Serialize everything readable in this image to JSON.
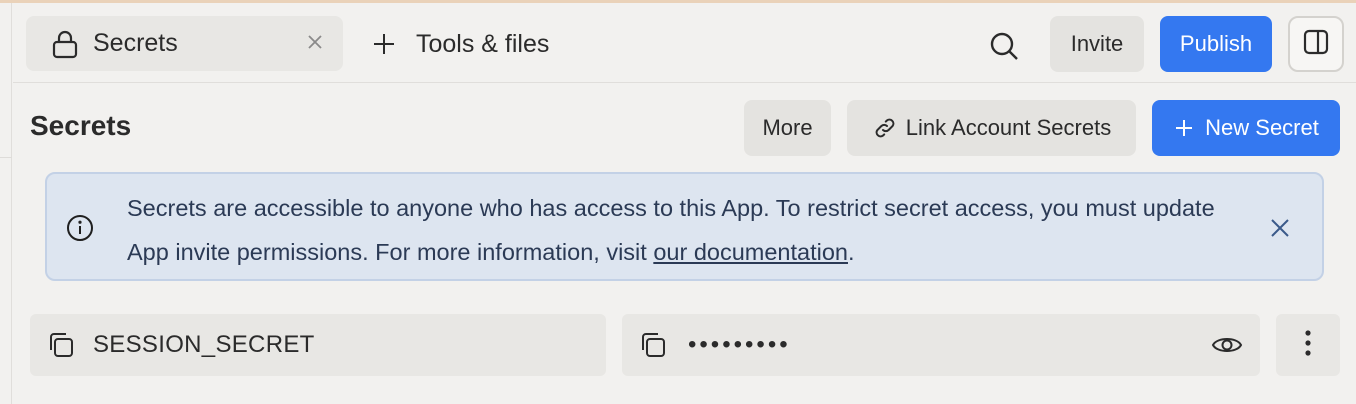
{
  "tabs": {
    "active": {
      "label": "Secrets",
      "icon": "lock-icon"
    },
    "add_label": "Tools & files"
  },
  "header": {
    "invite_label": "Invite",
    "publish_label": "Publish"
  },
  "section": {
    "title": "Secrets",
    "more_label": "More",
    "link_label": "Link Account Secrets",
    "new_label": "New Secret"
  },
  "banner": {
    "text": "Secrets are accessible to anyone who has access to this App. To restrict secret access, you must update App invite permissions. For more information, visit ",
    "link_text": "our documentation",
    "suffix": "."
  },
  "secrets": [
    {
      "key": "SESSION_SECRET",
      "masked_value": "•••••••••"
    }
  ],
  "colors": {
    "accent": "#3478f0",
    "banner_bg": "#dde5f0",
    "background": "#f2f1ef"
  }
}
